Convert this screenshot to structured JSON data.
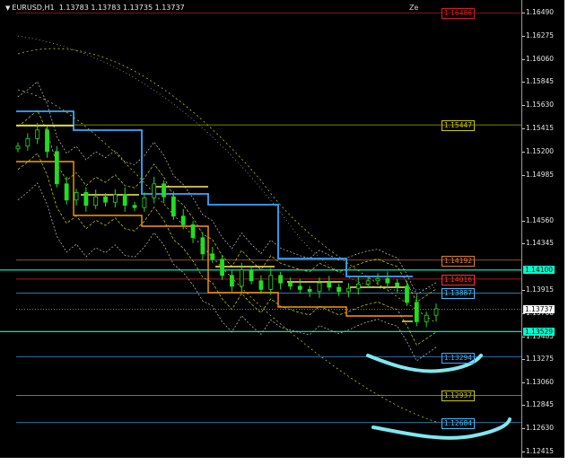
{
  "header": {
    "menu_icon": "triangle-down-icon",
    "symbol_timeframe": "EURUSD,H1",
    "ohlc": "1.13783 1.13783 1.13735 1.13737",
    "corner_label": "Ze"
  },
  "price_axis": {
    "ticks": [
      "1.16490",
      "1.16275",
      "1.16060",
      "1.15845",
      "1.15630",
      "1.15415",
      "1.15200",
      "1.14985",
      "1.14560",
      "1.14345",
      "1.13915",
      "1.13700",
      "1.13485",
      "1.13275",
      "1.13060",
      "1.12845",
      "1.12630",
      "1.12415"
    ],
    "current_price": "1.13737",
    "badges": [
      {
        "label": "1.14100",
        "color": "#00ffcc"
      },
      {
        "label": "1.13529",
        "color": "#00ffcc"
      }
    ]
  },
  "levels": [
    {
      "label": "1.16486",
      "color": "#d02020"
    },
    {
      "label": "1.15447",
      "color": "#c8c800"
    },
    {
      "label": "1.14192",
      "color": "#e08030"
    },
    {
      "label": "1.14016",
      "color": "#ff3030"
    },
    {
      "label": "1.13887",
      "color": "#40c0ff"
    },
    {
      "label": "1.13294",
      "color": "#40a8ff"
    },
    {
      "label": "1.12937",
      "color": "#c8c800"
    },
    {
      "label": "1.12684",
      "color": "#40c0ff"
    }
  ],
  "colors": {
    "background": "#000000",
    "candles": "#22dd22",
    "moving_average": "#ccdd00",
    "envelope": "#c8c8c8",
    "blue_step": "#3aa8ff",
    "orange_step": "#ff9900",
    "yellow_segments": "#ffee55",
    "annotation_curve": "#7fe8f0"
  },
  "chart_data": {
    "type": "candlestick",
    "symbol": "EURUSD",
    "timeframe": "H1",
    "ylim": [
      1.12415,
      1.1649
    ],
    "last_price": 1.13737,
    "close_path": [
      1.1525,
      1.1532,
      1.154,
      1.152,
      1.149,
      1.1475,
      1.1482,
      1.147,
      1.1478,
      1.1473,
      1.148,
      1.147,
      1.1468,
      1.1477,
      1.149,
      1.1478,
      1.146,
      1.1452,
      1.144,
      1.1425,
      1.142,
      1.1405,
      1.1395,
      1.141,
      1.14,
      1.1392,
      1.1405,
      1.1398,
      1.1395,
      1.1392,
      1.139,
      1.1398,
      1.1394,
      1.139,
      1.1393,
      1.1397,
      1.14,
      1.1402,
      1.1398,
      1.1395,
      1.138,
      1.1362,
      1.1368,
      1.1374
    ]
  }
}
